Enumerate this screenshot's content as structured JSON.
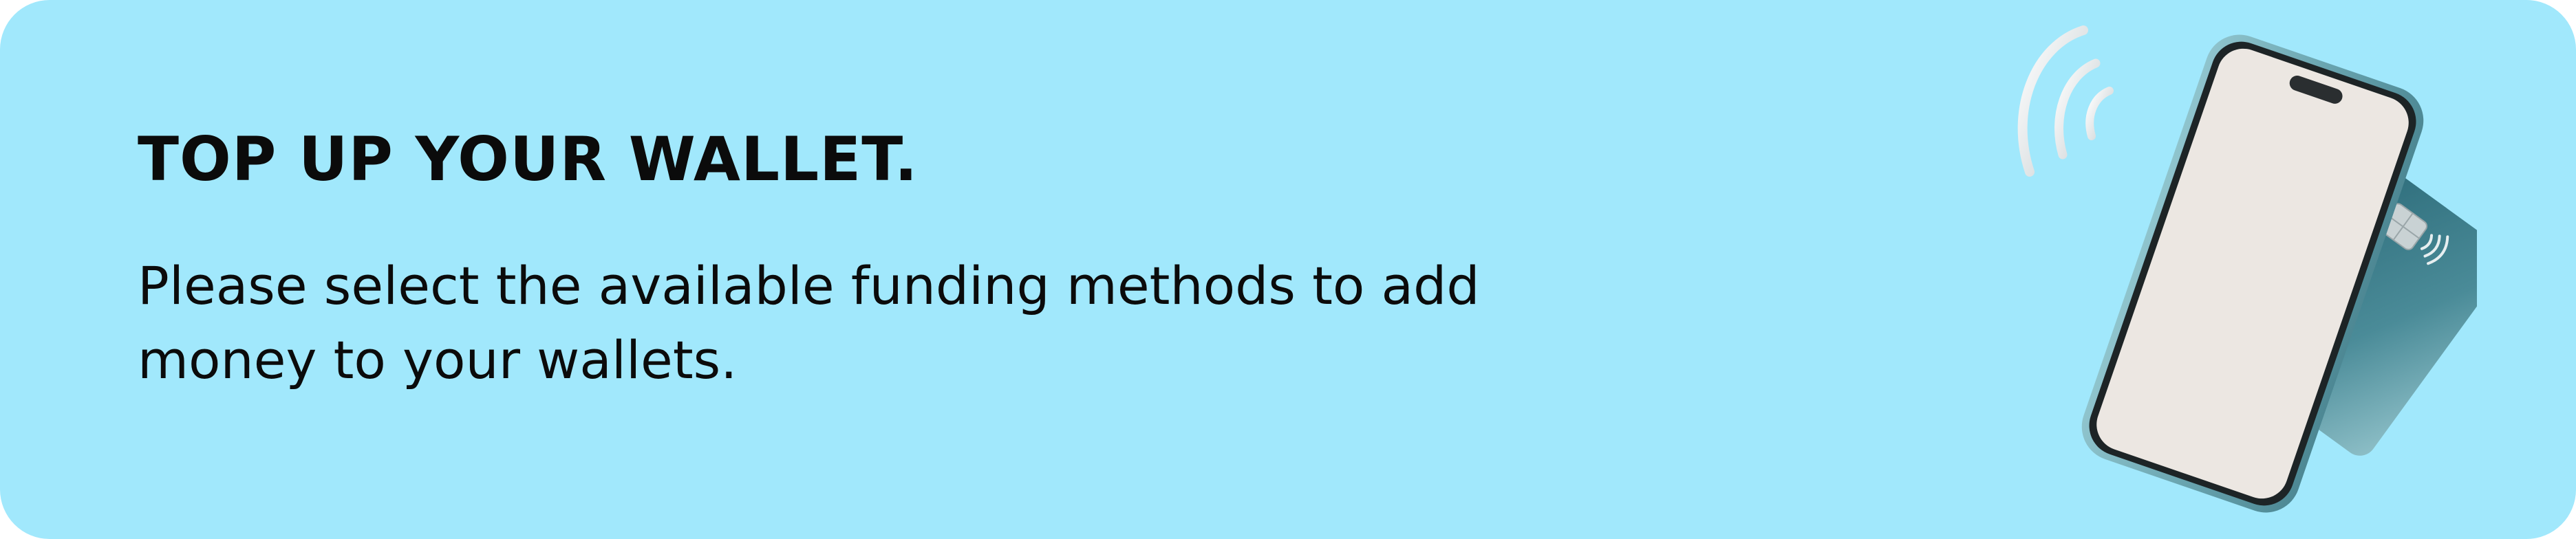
{
  "banner": {
    "title": "TOP UP YOUR WALLET.",
    "description": "Please select the available funding methods to add money to your wallets.",
    "illustration": {
      "icons": [
        "contactless-signal-icon",
        "smartphone-icon",
        "payment-card-icon",
        "card-chip-icon",
        "card-contactless-icon"
      ]
    }
  },
  "colors": {
    "background": "#a1e8fc",
    "text": "#0b0b0b",
    "phone_frame": "#6fa9b3",
    "phone_screen": "#ece7e2",
    "card": "#3e7d8a"
  }
}
